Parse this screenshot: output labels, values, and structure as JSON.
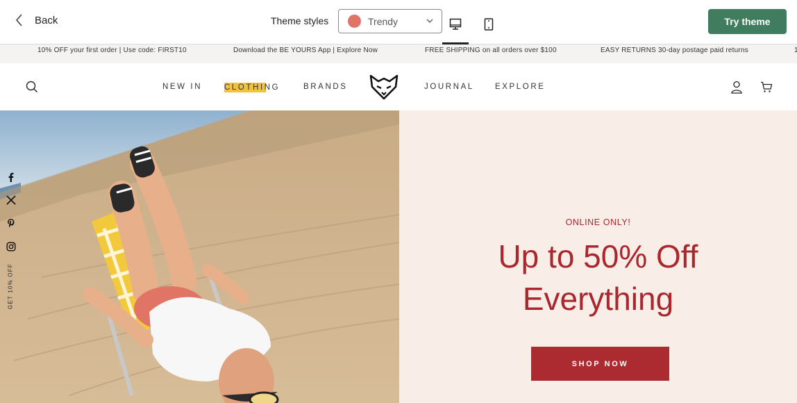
{
  "editor": {
    "back_label": "Back",
    "theme_styles_label": "Theme styles",
    "theme_value": "Trendy",
    "theme_swatch_color": "#e07468",
    "try_button": "Try theme",
    "try_button_color": "#3f7d5e",
    "active_device": "desktop"
  },
  "announcement": {
    "items": [
      "10% OFF your first order | Use code: FIRST10",
      "Download the BE YOURS App | Explore Now",
      "FREE SHIPPING on all orders over $100",
      "EASY RETURNS 30-day postage paid returns",
      "1"
    ]
  },
  "header": {
    "nav": [
      {
        "label": "NEW IN"
      },
      {
        "label": "CLOTHING"
      },
      {
        "label": "BRANDS"
      },
      {
        "label": "JOURNAL"
      },
      {
        "label": "EXPLORE"
      }
    ],
    "active_nav": "CLOTHING",
    "highlight_color": "#f0c23f"
  },
  "hero": {
    "eyebrow": "ONLINE ONLY!",
    "headline_line1": "Up to 50% Off",
    "headline_line2": "Everything",
    "cta": "SHOP NOW",
    "accent_color": "#a8282e",
    "panel_color": "#f9ede7"
  },
  "social": {
    "icons": [
      "facebook-icon",
      "x-icon",
      "pinterest-icon",
      "instagram-icon"
    ],
    "side_promo": "GET 10% OFF"
  }
}
